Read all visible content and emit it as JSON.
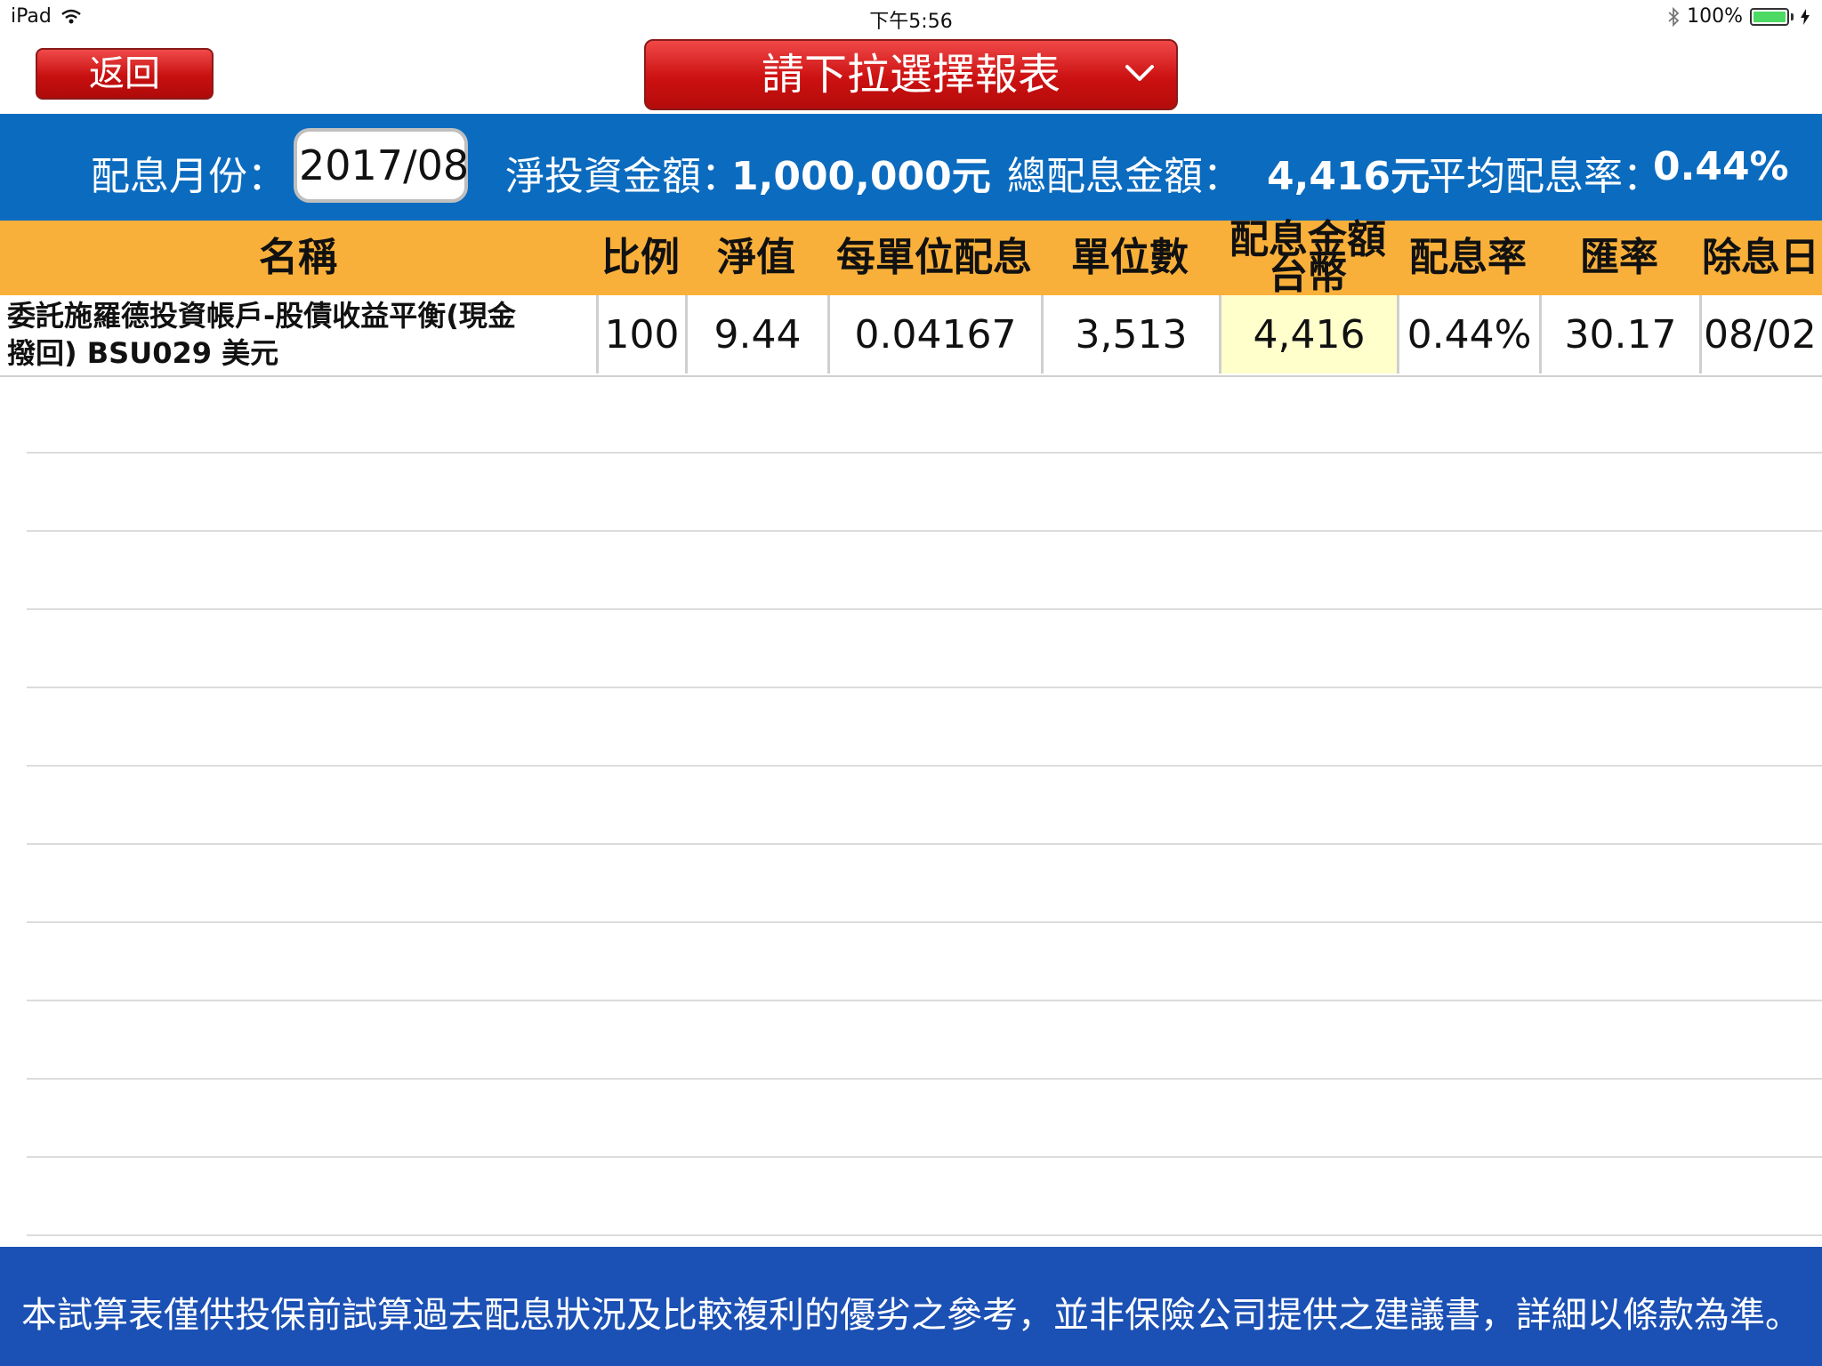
{
  "status_bar": {
    "device": "iPad",
    "time": "下午5:56",
    "battery": "100%",
    "battery_level": 1.0,
    "wifi_icon": "wifi-icon",
    "bluetooth_icon": "bluetooth-icon",
    "charging_icon": "bolt-icon"
  },
  "toolbar": {
    "back_label": "返回",
    "report_select_label": "請下拉選擇報表",
    "accent_color": "#d61a1a"
  },
  "summary": {
    "month_label": "配息月份：",
    "month_value": "2017/08",
    "net_investment_label": "淨投資金額：",
    "net_investment_value": "1,000,000元",
    "total_dividend_label": "總配息金額：",
    "total_dividend_value": "4,416元",
    "avg_rate_label": "平均配息率：",
    "avg_rate_value": "0.44%",
    "bar_color": "#0b6bbf"
  },
  "table": {
    "header_color": "#f9b03a",
    "columns": {
      "name": "名稱",
      "ratio": "比例",
      "nav": "淨值",
      "dividend_per_unit": "每單位配息",
      "units": "單位數",
      "dividend_amount_line1": "配息金額",
      "dividend_amount_line2": "台幣",
      "dividend_rate": "配息率",
      "fx_rate": "匯率",
      "ex_date": "除息日"
    },
    "rows": [
      {
        "name_line1": "委託施羅德投資帳戶-股債收益平衡(現金",
        "name_line2": "撥回) BSU029 美元",
        "ratio": "100",
        "nav": "9.44",
        "dividend_per_unit": "0.04167",
        "units": "3,513",
        "dividend_amount": "4,416",
        "dividend_rate": "0.44%",
        "fx_rate": "30.17",
        "ex_date": "08/02"
      }
    ]
  },
  "footer": {
    "disclaimer": "本試算表僅供投保前試算過去配息狀況及比較複利的優劣之參考，並非保險公司提供之建議書，詳細以條款為準。",
    "bar_color": "#1b50b4"
  }
}
